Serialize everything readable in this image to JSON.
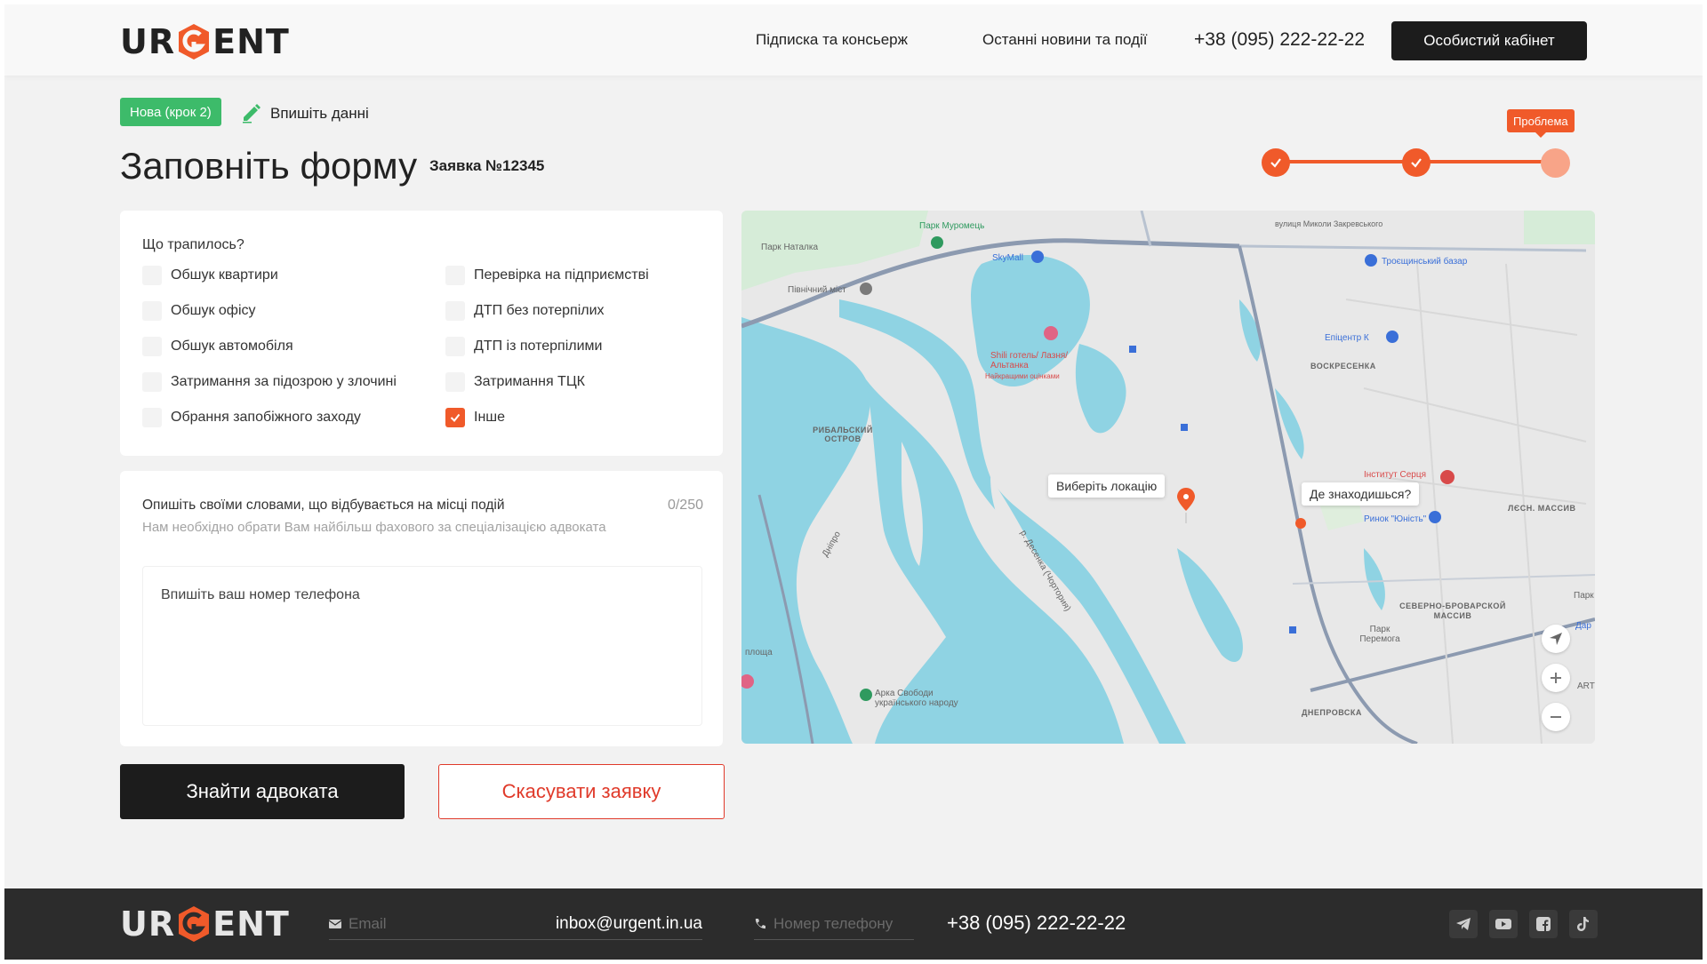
{
  "header": {
    "logo_text": "URGENT",
    "nav": [
      "Підписка та консьерж",
      "Останні новини та події"
    ],
    "phone": "+38 (095) 222-22-22",
    "cabinet_button": "Особистий кабінет"
  },
  "status": {
    "badge": "Нова (крок 2)",
    "edit_label": "Впишіть данні"
  },
  "title": "Заповніть форму",
  "order_number": "Заявка №12345",
  "stepper": {
    "tooltip": "Проблема",
    "steps_total": 3,
    "steps_completed": 2
  },
  "question": {
    "title": "Що трапилось?",
    "options_left": [
      {
        "label": "Обшук квартири",
        "checked": false
      },
      {
        "label": "Обшук офісу",
        "checked": false
      },
      {
        "label": "Обшук автомобіля",
        "checked": false
      },
      {
        "label": "Затримання за підозрою у злочині",
        "checked": false
      },
      {
        "label": "Обрання запобіжного заходу",
        "checked": false
      }
    ],
    "options_right": [
      {
        "label": "Перевірка на підприємстві",
        "checked": false
      },
      {
        "label": "ДТП без потерпілих",
        "checked": false
      },
      {
        "label": "ДТП із потерпілими",
        "checked": false
      },
      {
        "label": "Затримання ТЦК",
        "checked": false
      },
      {
        "label": "Інше",
        "checked": true
      }
    ]
  },
  "description": {
    "title": "Опишіть своїми словами, що відбувається на місці подій",
    "counter": "0/250",
    "hint": "Нам необхідно обрати Вам найбільш фахового за спеціалізацією адвоката",
    "placeholder": "Впишіть ваш номер телефона"
  },
  "buttons": {
    "find": "Знайти адвоката",
    "cancel": "Скасувати заявку"
  },
  "map": {
    "tip_choose": "Виберіть локацію",
    "tip_where": "Де знаходишься?",
    "labels": {
      "park_muromets": "Парк Муромець",
      "park_natalka": "Парк Наталка",
      "skymall": "SkyMall",
      "north_bridge": "Північний міст",
      "street_top": "вулиця Миколи Закревського",
      "troieshchyna": "Троєщинський базар",
      "epicentr": "Епіцентр К",
      "voskresenka": "ВОСКРЕСЕНКА",
      "shili": "Shili готель/ Лазня/Альтанка",
      "shili_sub": "Найкращими оцінками",
      "rybalskyi": "РИБАЛЬСКИЙ ОСТРОВ",
      "institute": "Інститут Серця",
      "rynok": "Ринок \"Юність\"",
      "lisovyi": "ЛЄСН. МАССИВ",
      "severo": "СЕВЕРНО-БРОВАРСКОЙ МАССИВ",
      "park_peremoha": "Парк Перемога",
      "arka": "Арка Свободи українського народу",
      "dnipro": "Дніпро",
      "desenka": "р. Десенка (Чортория)",
      "dniprovska": "ДНЕПРОВСКА",
      "ploshcha": "площа",
      "park_right": "Парк",
      "dar": "Дар",
      "art": "ART"
    }
  },
  "footer": {
    "logo_text": "URGENT",
    "email_placeholder": "Email",
    "email_value": "inbox@urgent.in.ua",
    "phone_placeholder": "Номер телефону",
    "phone_value": "+38 (095) 222-22-22"
  },
  "colors": {
    "accent": "#f05a2a",
    "success": "#3dbb6a",
    "dark": "#1c1c1c",
    "danger": "#e03a2a"
  }
}
